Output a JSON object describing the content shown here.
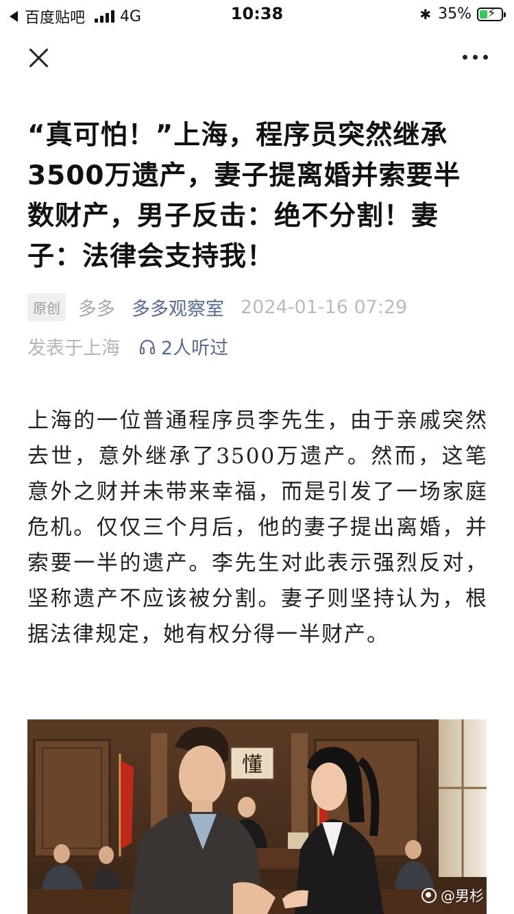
{
  "status_bar": {
    "back_app": "百度贴吧",
    "network": "4G",
    "time": "10:38",
    "battery_percent": "35%",
    "battery_level": 0.35,
    "icons": [
      "back-triangle-icon",
      "signal-icon",
      "bluetooth-icon",
      "battery-charging-icon"
    ]
  },
  "nav": {
    "close_icon": "close-icon",
    "more_icon": "more-icon"
  },
  "article": {
    "title": "“真可怕！”上海，程序员突然继承3500万遗产，妻子提离婚并索要半数财产，男子反击：绝不分割！妻子：法律会支持我！",
    "badge": "原创",
    "author": "多多",
    "account": "多多观察室",
    "datetime": "2024-01-16 07:29",
    "location": "发表于上海",
    "listens": "2人听过",
    "body": "上海的一位普通程序员李先生，由于亲戚突然去世，意外继承了3500万遗产。然而，这笔意外之财并未带来幸福，而是引发了一场家庭危机。仅仅三个月后，他的妻子提出离婚，并索要一半的遗产。李先生对此表示强烈反对，坚称遗产不应该被分割。妻子则坚持认为，根据法律规定，她有权分得一半财产。",
    "image": {
      "wall_character": "懂",
      "watermark": "@男杉"
    }
  },
  "colors": {
    "link": "#576b95",
    "meta_gray": "#b5b5b5",
    "battery_green": "#34c759"
  }
}
